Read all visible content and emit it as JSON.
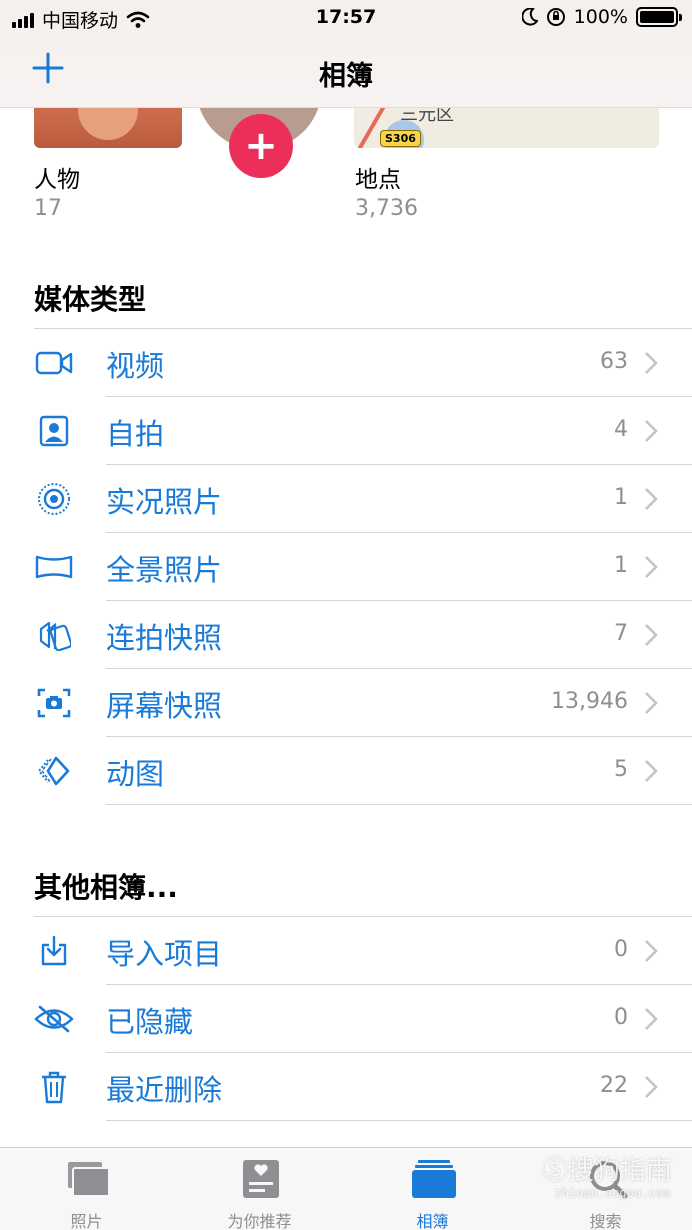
{
  "status": {
    "carrier": "中国移动",
    "time": "17:57",
    "battery": "100%"
  },
  "nav": {
    "title": "相簿"
  },
  "map": {
    "road_shield": "S306",
    "district": "三元区"
  },
  "categories": [
    {
      "label": "人物",
      "count": "17"
    },
    {
      "label": "地点",
      "count": "3,736"
    }
  ],
  "media_types": {
    "title": "媒体类型",
    "items": [
      {
        "label": "视频",
        "count": "63",
        "icon": "video-icon"
      },
      {
        "label": "自拍",
        "count": "4",
        "icon": "selfie-icon"
      },
      {
        "label": "实况照片",
        "count": "1",
        "icon": "live-photo-icon"
      },
      {
        "label": "全景照片",
        "count": "1",
        "icon": "panorama-icon"
      },
      {
        "label": "连拍快照",
        "count": "7",
        "icon": "burst-icon"
      },
      {
        "label": "屏幕快照",
        "count": "13,946",
        "icon": "screenshot-icon"
      },
      {
        "label": "动图",
        "count": "5",
        "icon": "animated-icon"
      }
    ]
  },
  "other_albums": {
    "title": "其他相簿...",
    "items": [
      {
        "label": "导入项目",
        "count": "0",
        "icon": "import-icon"
      },
      {
        "label": "已隐藏",
        "count": "0",
        "icon": "hidden-eye-icon"
      },
      {
        "label": "最近删除",
        "count": "22",
        "icon": "trash-icon"
      }
    ]
  },
  "tabs": [
    {
      "label": "照片",
      "icon": "photos-icon",
      "active": false
    },
    {
      "label": "为你推荐",
      "icon": "for-you-icon",
      "active": false
    },
    {
      "label": "相簿",
      "icon": "albums-icon",
      "active": true
    },
    {
      "label": "搜索",
      "icon": "search-icon",
      "active": false
    }
  ],
  "watermark": {
    "text": "搜狗指南",
    "sub": "zhinan.sogou.com"
  },
  "colors": {
    "accent": "#1a7ad8",
    "secondary_text": "#8e8e93",
    "badge_red": "#ec2f5a"
  }
}
